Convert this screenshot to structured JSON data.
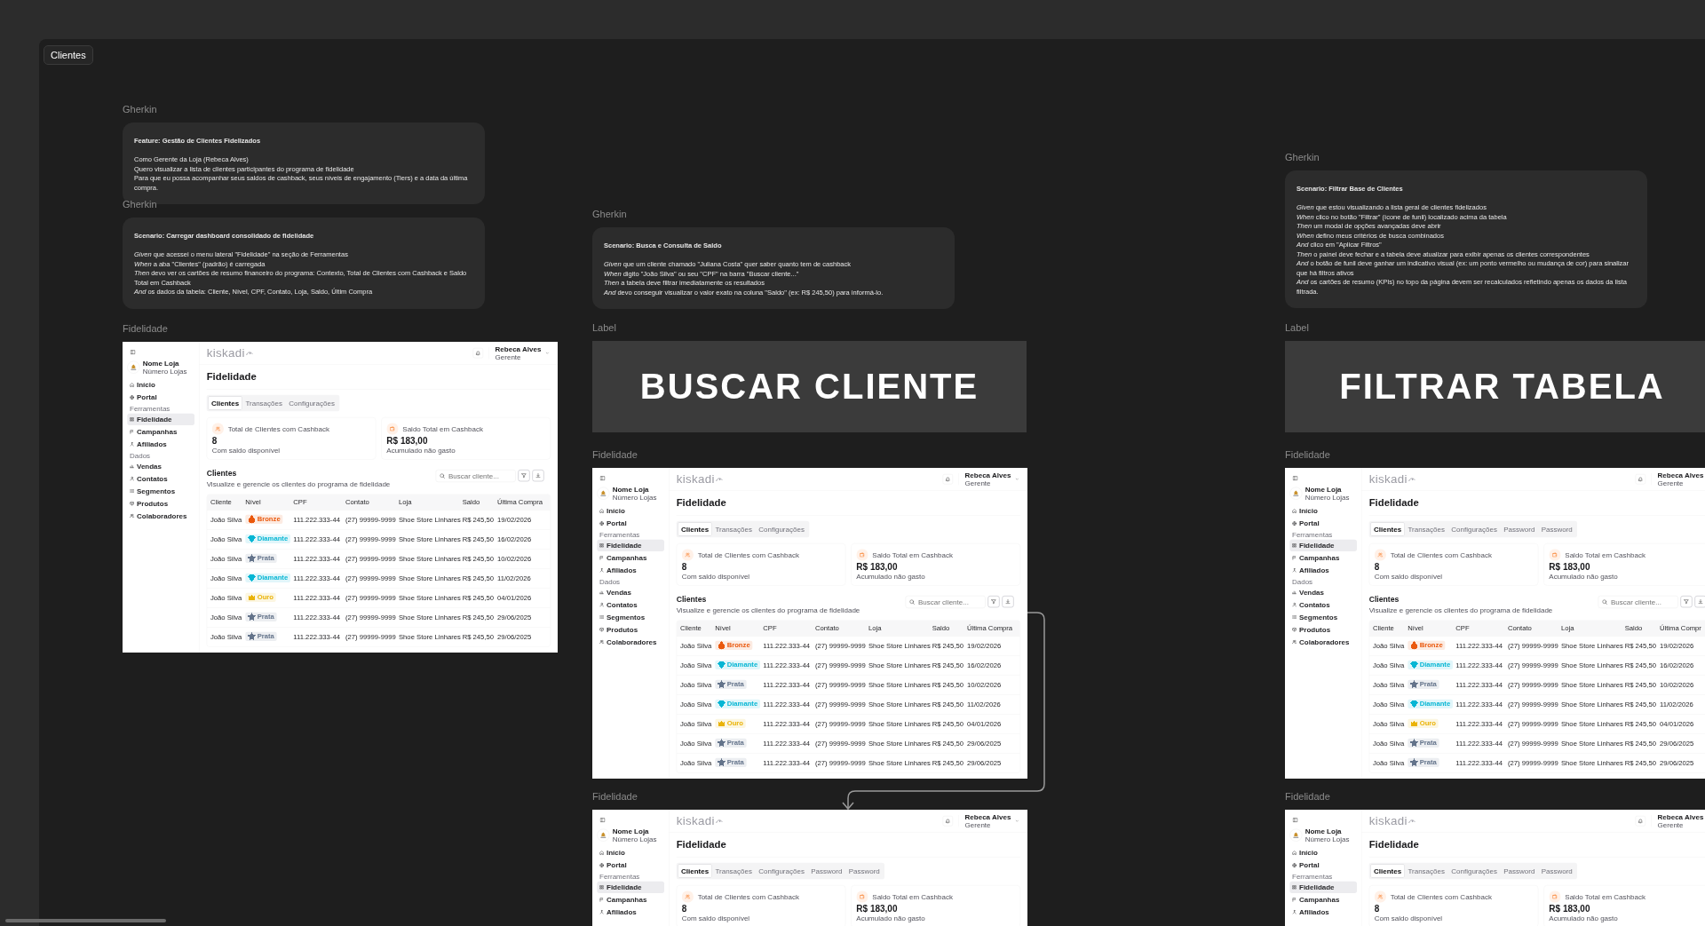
{
  "frame_label": "Clientes",
  "blocks": [
    {
      "kind": "note",
      "caption": "Gherkin",
      "heading": "Feature: Gestão de Clientes Fidelizados",
      "lines": [
        "Como Gerente da Loja (Rebeca Alves)",
        "Quero visualizar a lista de clientes participantes do programa de fidelidade",
        "Para que eu possa acompanhar seus saldos de cashback, seus níveis de engajamento (Tiers) e a data da última compra."
      ]
    },
    {
      "kind": "note",
      "caption": "Gherkin",
      "heading": "Scenario: Carregar dashboard consolidado de fidelidade",
      "lines": [
        "*Given* que acessei o menu lateral \"Fidelidade\" na seção de Ferramentas",
        "*When* a aba \"Clientes\" (padrão) é carregada",
        "*Then* devo ver os cartões de resumo financeiro do programa: Contexto, Total de Clientes com Cashback e Saldo Total em Cashback",
        "*And* os dados da tabela: Cliente, Nível, CPF, Contato, Loja, Saldo, Últim Compra"
      ]
    },
    {
      "kind": "mockup",
      "caption": "Fidelidade",
      "app": {
        "logo": "kiskadi",
        "store": {
          "name": "Nome Loja",
          "subtitle": "Número Lojas"
        },
        "sidebar": [
          {
            "items": [
              {
                "label": "Início",
                "selected": false
              },
              {
                "label": "Portal",
                "selected": false
              }
            ]
          },
          {
            "title": "Ferramentas",
            "items": [
              {
                "label": "Fidelidade",
                "selected": true
              },
              {
                "label": "Campanhas",
                "selected": false
              },
              {
                "label": "Afiliados",
                "selected": false
              }
            ]
          },
          {
            "title": "Dados",
            "items": [
              {
                "label": "Vendas",
                "selected": false
              },
              {
                "label": "Contatos",
                "selected": false
              },
              {
                "label": "Segmentos",
                "selected": false
              },
              {
                "label": "Produtos",
                "selected": false
              },
              {
                "label": "Colaboradores",
                "selected": false
              }
            ]
          }
        ],
        "user": {
          "name": "Rebeca Alves",
          "role": "Gerente"
        },
        "title": "Fidelidade",
        "tabs": [
          {
            "label": "Clientes",
            "selected": true
          },
          {
            "label": "Transações",
            "selected": false
          },
          {
            "label": "Configurações",
            "selected": false
          }
        ],
        "kpis": [
          {
            "label": "Total de Clientes com Cashback",
            "value": "8",
            "note": "Com saldo disponível"
          },
          {
            "label": "Saldo Total em Cashback",
            "value": "R$ 183,00",
            "note": "Acumulado não gasto"
          }
        ],
        "clients": {
          "heading": "Clientes",
          "subtitle": "Visualize e gerencie os clientes do programa de fidelidade",
          "search": {
            "placeholder": "Buscar cliente..."
          },
          "columns": [
            "Cliente",
            "Nível",
            "CPF",
            "Contato",
            "Loja",
            "Saldo",
            "Última Compra"
          ],
          "rows": [
            {
              "client": "João Silva",
              "tier": {
                "kind": "bronze",
                "label": "Bronze",
                "color": "#ea580c"
              },
              "cpf": "111.222.333-44",
              "contact": "(27) 99999-9999",
              "store": "Shoe Store Linhares",
              "balance": "R$ 245,50",
              "last_purchase": "19/02/2026"
            },
            {
              "client": "João Silva",
              "tier": {
                "kind": "diamond",
                "label": "Diamante",
                "color": "#06b6d4"
              },
              "cpf": "111.222.333-44",
              "contact": "(27) 99999-9999",
              "store": "Shoe Store Linhares",
              "balance": "R$ 245,50",
              "last_purchase": "16/02/2026"
            },
            {
              "client": "João Silva",
              "tier": {
                "kind": "silver",
                "label": "Prata",
                "color": "#64748b"
              },
              "cpf": "111.222.333-44",
              "contact": "(27) 99999-9999",
              "store": "Shoe Store Linhares",
              "balance": "R$ 245,50",
              "last_purchase": "10/02/2026"
            },
            {
              "client": "João Silva",
              "tier": {
                "kind": "diamond",
                "label": "Diamante",
                "color": "#06b6d4"
              },
              "cpf": "111.222.333-44",
              "contact": "(27) 99999-9999",
              "store": "Shoe Store Linhares",
              "balance": "R$ 245,50",
              "last_purchase": "11/02/2026"
            },
            {
              "client": "João Silva",
              "tier": {
                "kind": "gold",
                "label": "Ouro",
                "color": "#eab308"
              },
              "cpf": "111.222.333-44",
              "contact": "(27) 99999-9999",
              "store": "Shoe Store Linhares",
              "balance": "R$ 245,50",
              "last_purchase": "04/01/2026"
            },
            {
              "client": "João Silva",
              "tier": {
                "kind": "silver",
                "label": "Prata",
                "color": "#64748b"
              },
              "cpf": "111.222.333-44",
              "contact": "(27) 99999-9999",
              "store": "Shoe Store Linhares",
              "balance": "R$ 245,50",
              "last_purchase": "29/06/2025"
            },
            {
              "client": "João Silva",
              "tier": {
                "kind": "silver",
                "label": "Prata",
                "color": "#64748b"
              },
              "cpf": "111.222.333-44",
              "contact": "(27) 99999-9999",
              "store": "Shoe Store Linhares",
              "balance": "R$ 245,50",
              "last_purchase": "29/06/2025"
            }
          ]
        }
      }
    },
    {
      "kind": "note",
      "caption": "Gherkin",
      "heading": "Scenario: Busca e Consulta de Saldo",
      "lines": [
        "*Given* que um cliente chamado \"Juliana Costa\" quer saber quanto tem de cashback",
        "*When* digito \"João Silva\" ou seu \"CPF\" na barra \"Buscar cliente...\"",
        "*Then* a tabela deve filtrar imediatamente os resultados",
        "*And* devo conseguir visualizar o valor exato na coluna \"Saldo\" (ex: R$ 245,50) para informá-lo."
      ]
    },
    {
      "kind": "banner",
      "caption": "Label",
      "text": "BUSCAR CLIENTE"
    },
    {
      "kind": "mockup",
      "caption": "Fidelidade",
      "app": {
        "logo": "kiskadi",
        "store": {
          "name": "Nome Loja",
          "subtitle": "Número Lojas"
        },
        "sidebar": [
          {
            "items": [
              {
                "label": "Início",
                "selected": false
              },
              {
                "label": "Portal",
                "selected": false
              }
            ]
          },
          {
            "title": "Ferramentas",
            "items": [
              {
                "label": "Fidelidade",
                "selected": true
              },
              {
                "label": "Campanhas",
                "selected": false
              },
              {
                "label": "Afiliados",
                "selected": false
              }
            ]
          },
          {
            "title": "Dados",
            "items": [
              {
                "label": "Vendas",
                "selected": false
              },
              {
                "label": "Contatos",
                "selected": false
              },
              {
                "label": "Segmentos",
                "selected": false
              },
              {
                "label": "Produtos",
                "selected": false
              },
              {
                "label": "Colaboradores",
                "selected": false
              }
            ]
          }
        ],
        "user": {
          "name": "Rebeca Alves",
          "role": "Gerente"
        },
        "title": "Fidelidade",
        "tabs": [
          {
            "label": "Clientes",
            "selected": true
          },
          {
            "label": "Transações",
            "selected": false
          },
          {
            "label": "Configurações",
            "selected": false
          }
        ],
        "kpis": [
          {
            "label": "Total de Clientes com Cashback",
            "value": "8",
            "note": "Com saldo disponível"
          },
          {
            "label": "Saldo Total em Cashback",
            "value": "R$ 183,00",
            "note": "Acumulado não gasto"
          }
        ],
        "clients": {
          "heading": "Clientes",
          "subtitle": "Visualize e gerencie os clientes do programa de fidelidade",
          "search": {
            "placeholder": "Buscar cliente..."
          },
          "columns": [
            "Cliente",
            "Nível",
            "CPF",
            "Contato",
            "Loja",
            "Saldo",
            "Última Compra"
          ],
          "rows": [
            {
              "client": "João Silva",
              "tier": {
                "kind": "bronze",
                "label": "Bronze",
                "color": "#ea580c"
              },
              "cpf": "111.222.333-44",
              "contact": "(27) 99999-9999",
              "store": "Shoe Store Linhares",
              "balance": "R$ 245,50",
              "last_purchase": "19/02/2026"
            },
            {
              "client": "João Silva",
              "tier": {
                "kind": "diamond",
                "label": "Diamante",
                "color": "#06b6d4"
              },
              "cpf": "111.222.333-44",
              "contact": "(27) 99999-9999",
              "store": "Shoe Store Linhares",
              "balance": "R$ 245,50",
              "last_purchase": "16/02/2026"
            },
            {
              "client": "João Silva",
              "tier": {
                "kind": "silver",
                "label": "Prata",
                "color": "#64748b"
              },
              "cpf": "111.222.333-44",
              "contact": "(27) 99999-9999",
              "store": "Shoe Store Linhares",
              "balance": "R$ 245,50",
              "last_purchase": "10/02/2026"
            },
            {
              "client": "João Silva",
              "tier": {
                "kind": "diamond",
                "label": "Diamante",
                "color": "#06b6d4"
              },
              "cpf": "111.222.333-44",
              "contact": "(27) 99999-9999",
              "store": "Shoe Store Linhares",
              "balance": "R$ 245,50",
              "last_purchase": "11/02/2026"
            },
            {
              "client": "João Silva",
              "tier": {
                "kind": "gold",
                "label": "Ouro",
                "color": "#eab308"
              },
              "cpf": "111.222.333-44",
              "contact": "(27) 99999-9999",
              "store": "Shoe Store Linhares",
              "balance": "R$ 245,50",
              "last_purchase": "04/01/2026"
            },
            {
              "client": "João Silva",
              "tier": {
                "kind": "silver",
                "label": "Prata",
                "color": "#64748b"
              },
              "cpf": "111.222.333-44",
              "contact": "(27) 99999-9999",
              "store": "Shoe Store Linhares",
              "balance": "R$ 245,50",
              "last_purchase": "29/06/2025"
            },
            {
              "client": "João Silva",
              "tier": {
                "kind": "silver",
                "label": "Prata",
                "color": "#64748b"
              },
              "cpf": "111.222.333-44",
              "contact": "(27) 99999-9999",
              "store": "Shoe Store Linhares",
              "balance": "R$ 245,50",
              "last_purchase": "29/06/2025"
            }
          ]
        }
      }
    },
    {
      "kind": "mockup",
      "caption": "Fidelidade",
      "app": {
        "logo": "kiskadi",
        "store": {
          "name": "Nome Loja",
          "subtitle": "Número Lojas"
        },
        "sidebar": [
          {
            "items": [
              {
                "label": "Início",
                "selected": false
              },
              {
                "label": "Portal",
                "selected": false
              }
            ]
          },
          {
            "title": "Ferramentas",
            "items": [
              {
                "label": "Fidelidade",
                "selected": true
              },
              {
                "label": "Campanhas",
                "selected": false
              },
              {
                "label": "Afiliados",
                "selected": false
              }
            ]
          }
        ],
        "user": {
          "name": "Rebeca Alves",
          "role": "Gerente"
        },
        "title": "Fidelidade",
        "tabs": [
          {
            "label": "Clientes",
            "selected": true
          },
          {
            "label": "Transações",
            "selected": false
          },
          {
            "label": "Configurações",
            "selected": false
          },
          {
            "label": "Password",
            "selected": false
          },
          {
            "label": "Password",
            "selected": false
          }
        ],
        "kpis": [
          {
            "label": "Total de Clientes com Cashback",
            "value": "8",
            "note": "Com saldo disponível"
          },
          {
            "label": "Saldo Total em Cashback",
            "value": "R$ 183,00",
            "note": "Acumulado não gasto"
          }
        ]
      }
    },
    {
      "kind": "note",
      "caption": "Gherkin",
      "heading": "Scenario: Filtrar Base de Clientes",
      "lines": [
        "*Given* que estou visualizando a lista geral de clientes fidelizados",
        "*When* clico no botão \"Filtrar\" (ícone de funil) localizado acima da tabela",
        "*Then* um modal de opções avançadas deve abrir",
        "*When* defino meus critérios de busca combinados",
        "*And* clico em \"Aplicar Filtros\"",
        "*Then* o painel deve fechar e a tabela deve atualizar para exibir apenas os clientes correspondentes",
        "*And* o botão de funil deve ganhar um indicativo visual (ex: um ponto vermelho ou mudança de cor) para sinalizar que há filtros ativos",
        "*And* os cartões de resumo (KPIs) no topo da página devem ser recalculados refletindo apenas os dados da lista filtrada."
      ]
    },
    {
      "kind": "banner",
      "caption": "Label",
      "text": "FILTRAR TABELA"
    },
    {
      "kind": "mockup",
      "caption": "Fidelidade",
      "app": {
        "logo": "kiskadi",
        "store": {
          "name": "Nome Loja",
          "subtitle": "Número Lojas"
        },
        "sidebar": [
          {
            "items": [
              {
                "label": "Início",
                "selected": false
              },
              {
                "label": "Portal",
                "selected": false
              }
            ]
          },
          {
            "title": "Ferramentas",
            "items": [
              {
                "label": "Fidelidade",
                "selected": true
              },
              {
                "label": "Campanhas",
                "selected": false
              },
              {
                "label": "Afiliados",
                "selected": false
              }
            ]
          },
          {
            "title": "Dados",
            "items": [
              {
                "label": "Vendas",
                "selected": false
              },
              {
                "label": "Contatos",
                "selected": false
              },
              {
                "label": "Segmentos",
                "selected": false
              },
              {
                "label": "Produtos",
                "selected": false
              },
              {
                "label": "Colaboradores",
                "selected": false
              }
            ]
          }
        ],
        "user": {
          "name": "Rebeca Alves",
          "role": "Gerente"
        },
        "title": "Fidelidade",
        "tabs": [
          {
            "label": "Clientes",
            "selected": true
          },
          {
            "label": "Transações",
            "selected": false
          },
          {
            "label": "Configurações",
            "selected": false
          },
          {
            "label": "Password",
            "selected": false
          },
          {
            "label": "Password",
            "selected": false
          }
        ],
        "kpis": [
          {
            "label": "Total de Clientes com Cashback",
            "value": "8",
            "note": "Com saldo disponível"
          },
          {
            "label": "Saldo Total em Cashback",
            "value": "R$ 183,00",
            "note": "Acumulado não gasto"
          }
        ],
        "clients": {
          "heading": "Clientes",
          "subtitle": "Visualize e gerencie os clientes do programa de fidelidade",
          "search": {
            "placeholder": "Buscar cliente..."
          },
          "columns": [
            "Cliente",
            "Nível",
            "CPF",
            "Contato",
            "Loja",
            "Saldo",
            "Última Compr"
          ],
          "rows": [
            {
              "client": "João Silva",
              "tier": {
                "kind": "bronze",
                "label": "Bronze",
                "color": "#ea580c"
              },
              "cpf": "111.222.333-44",
              "contact": "(27) 99999-9999",
              "store": "Shoe Store Linhares",
              "balance": "R$ 245,50",
              "last_purchase": "19/02/2026"
            },
            {
              "client": "João Silva",
              "tier": {
                "kind": "diamond",
                "label": "Diamante",
                "color": "#06b6d4"
              },
              "cpf": "111.222.333-44",
              "contact": "(27) 99999-9999",
              "store": "Shoe Store Linhares",
              "balance": "R$ 245,50",
              "last_purchase": "16/02/2026"
            },
            {
              "client": "João Silva",
              "tier": {
                "kind": "silver",
                "label": "Prata",
                "color": "#64748b"
              },
              "cpf": "111.222.333-44",
              "contact": "(27) 99999-9999",
              "store": "Shoe Store Linhares",
              "balance": "R$ 245,50",
              "last_purchase": "10/02/2026"
            },
            {
              "client": "João Silva",
              "tier": {
                "kind": "diamond",
                "label": "Diamante",
                "color": "#06b6d4"
              },
              "cpf": "111.222.333-44",
              "contact": "(27) 99999-9999",
              "store": "Shoe Store Linhares",
              "balance": "R$ 245,50",
              "last_purchase": "11/02/2026"
            },
            {
              "client": "João Silva",
              "tier": {
                "kind": "gold",
                "label": "Ouro",
                "color": "#eab308"
              },
              "cpf": "111.222.333-44",
              "contact": "(27) 99999-9999",
              "store": "Shoe Store Linhares",
              "balance": "R$ 245,50",
              "last_purchase": "04/01/2026"
            },
            {
              "client": "João Silva",
              "tier": {
                "kind": "silver",
                "label": "Prata",
                "color": "#64748b"
              },
              "cpf": "111.222.333-44",
              "contact": "(27) 99999-9999",
              "store": "Shoe Store Linhares",
              "balance": "R$ 245,50",
              "last_purchase": "29/06/2025"
            },
            {
              "client": "João Silva",
              "tier": {
                "kind": "silver",
                "label": "Prata",
                "color": "#64748b"
              },
              "cpf": "111.222.333-44",
              "contact": "(27) 99999-9999",
              "store": "Shoe Store Linhares",
              "balance": "R$ 245,50",
              "last_purchase": "29/06/2025"
            }
          ]
        }
      }
    },
    {
      "kind": "mockup",
      "caption": "Fidelidade",
      "app": {
        "logo": "kiskadi",
        "store": {
          "name": "Nome Loja",
          "subtitle": "Número Lojas"
        },
        "sidebar": [
          {
            "items": [
              {
                "label": "Início",
                "selected": false
              },
              {
                "label": "Portal",
                "selected": false
              }
            ]
          },
          {
            "title": "Ferramentas",
            "items": [
              {
                "label": "Fidelidade",
                "selected": true
              },
              {
                "label": "Campanhas",
                "selected": false
              },
              {
                "label": "Afiliados",
                "selected": false
              }
            ]
          }
        ],
        "user": {
          "name": "Rebeca Alves",
          "role": "Gerente"
        },
        "title": "Fidelidade",
        "tabs": [
          {
            "label": "Clientes",
            "selected": true
          },
          {
            "label": "Transações",
            "selected": false
          },
          {
            "label": "Configurações",
            "selected": false
          },
          {
            "label": "Password",
            "selected": false
          },
          {
            "label": "Password",
            "selected": false
          }
        ],
        "kpis": [
          {
            "label": "Total de Clientes com Cashback",
            "value": "8",
            "note": "Com saldo disponível"
          },
          {
            "label": "Saldo Total em Cashback",
            "value": "R$ 183,00",
            "note": "Acumulado não gasto"
          }
        ]
      }
    }
  ]
}
